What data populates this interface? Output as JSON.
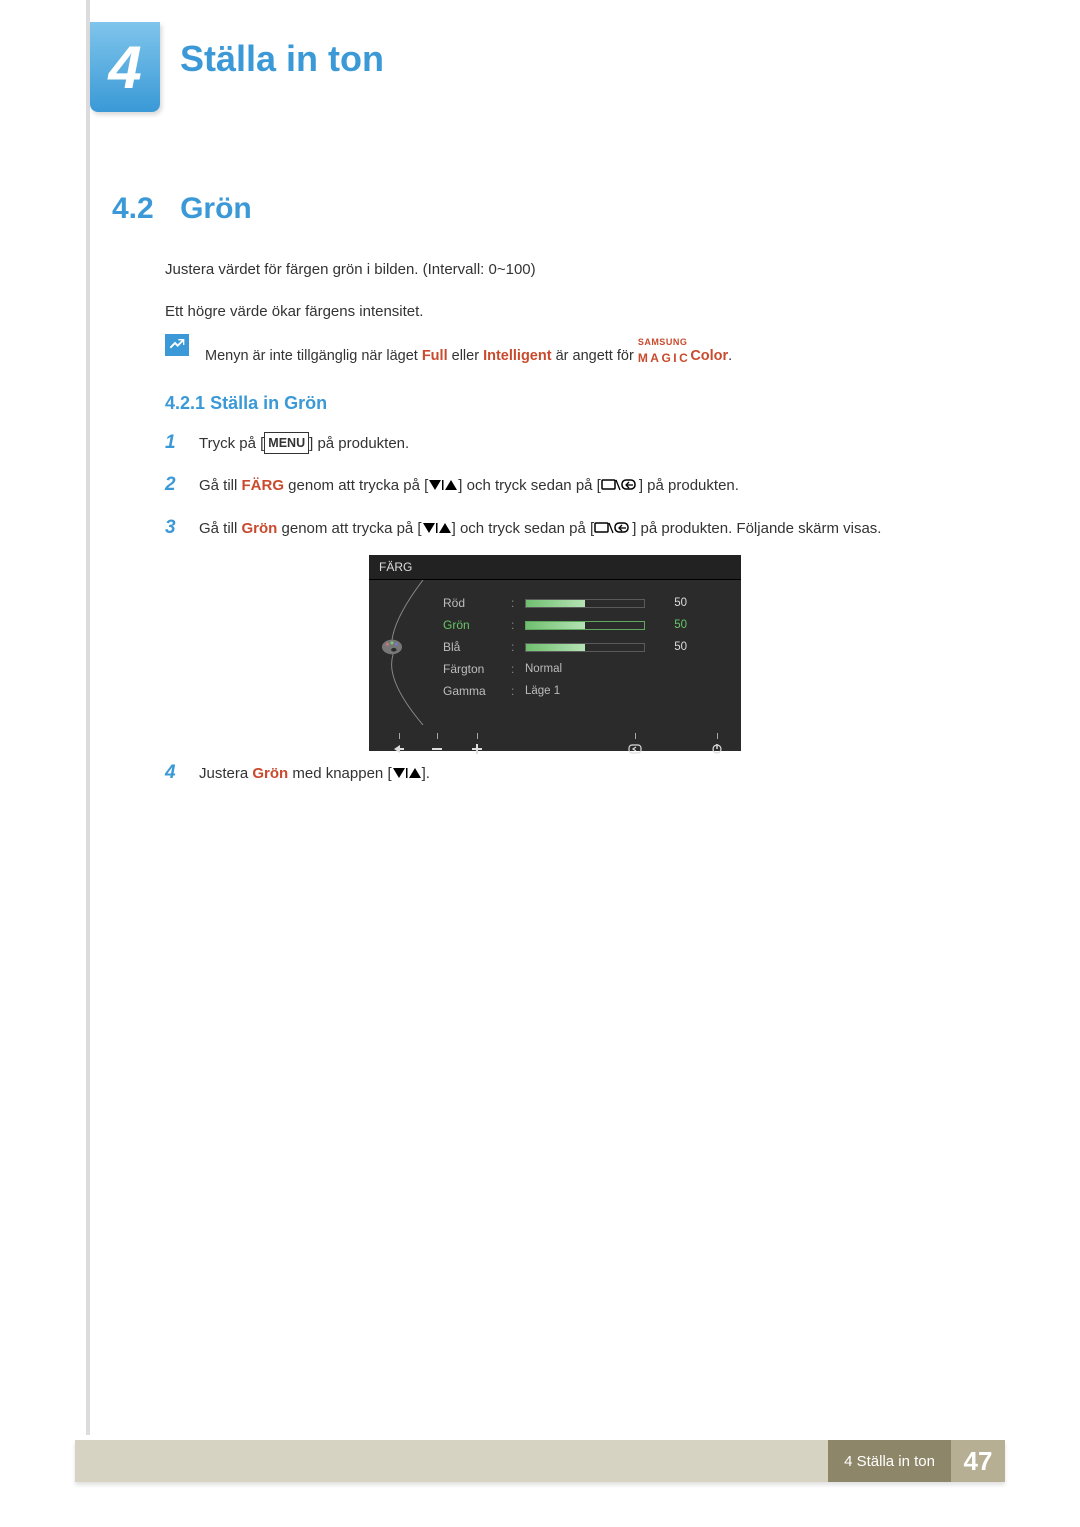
{
  "chapter": {
    "number": "4",
    "title": "Ställa in ton"
  },
  "section": {
    "number": "4.2",
    "title": "Grön"
  },
  "intro": {
    "line1": "Justera värdet för färgen grön i bilden. (Intervall: 0~100)",
    "line2": "Ett högre värde ökar färgens intensitet."
  },
  "note": {
    "prefix": "Menyn är inte tillgänglig när läget ",
    "full": "Full",
    "mid1": " eller ",
    "intelligent": "Intelligent",
    "mid2": " är angett för ",
    "magic_small": "SAMSUNG",
    "magic_big": "MAGIC",
    "color": "Color",
    "suffix": "."
  },
  "subsection": {
    "number": "4.2.1",
    "title": "Ställa in Grön"
  },
  "steps": {
    "s1": {
      "number": "1",
      "pre": "Tryck på [",
      "menu": "MENU",
      "post": "] på produkten."
    },
    "s2": {
      "number": "2",
      "pre": "Gå till ",
      "farg": "FÄRG",
      "mid1": " genom att trycka på [",
      "mid2": "] och tryck sedan på [",
      "post": "] på produkten."
    },
    "s3": {
      "number": "3",
      "pre": "Gå till ",
      "gron": "Grön",
      "mid1": " genom att trycka på [",
      "mid2": "] och tryck sedan på [",
      "post": "] på produkten. Följande skärm visas."
    },
    "s4": {
      "number": "4",
      "pre": "Justera ",
      "gron": "Grön",
      "mid": " med knappen [",
      "post": "]."
    }
  },
  "osd": {
    "title": "FÄRG",
    "rows": {
      "red": {
        "label": "Röd",
        "value": "50",
        "pct": 50
      },
      "green": {
        "label": "Grön",
        "value": "50",
        "pct": 50
      },
      "blue": {
        "label": "Blå",
        "value": "50",
        "pct": 50
      },
      "tone": {
        "label": "Färgton",
        "value": "Normal"
      },
      "gamma": {
        "label": "Gamma",
        "value": "Läge 1"
      }
    }
  },
  "footer": {
    "section": "4 Ställa in ton",
    "page": "47"
  }
}
